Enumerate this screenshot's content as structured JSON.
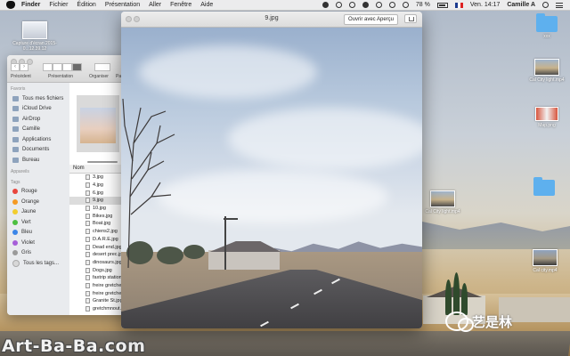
{
  "menubar": {
    "app": "Finder",
    "items": [
      "Fichier",
      "Édition",
      "Présentation",
      "Aller",
      "Fenêtre",
      "Aide"
    ],
    "battery": "78 %",
    "clock": "Ven. 14:17",
    "user": "Camille A"
  },
  "desktop": {
    "items": [
      {
        "label": "Capture d'écran 2015-0...12.39.12"
      },
      {
        "label": "xxx"
      },
      {
        "label": "Cal City light.mp4"
      },
      {
        "label": "Map.png"
      },
      {
        "label": "Cal City light.mp4"
      },
      {
        "label": ""
      },
      {
        "label": "Cal city.mp4"
      }
    ],
    "watermark": "Art-Ba-Ba.com",
    "wechat_text": "艺是林"
  },
  "finder": {
    "toolbar": {
      "back_label": "Précédent",
      "view_label": "Présentation",
      "arrange_label": "Organiser",
      "share_label": "Parta"
    },
    "sidebar": {
      "favorites_heading": "Favoris",
      "favorites": [
        "Tous mes fichiers",
        "iCloud Drive",
        "AirDrop",
        "Camille",
        "Applications",
        "Documents",
        "Bureau"
      ],
      "devices_heading": "Appareils",
      "tags_heading": "Tags",
      "tags": [
        {
          "label": "Rouge",
          "color": "#e8453c"
        },
        {
          "label": "Orange",
          "color": "#f59a23"
        },
        {
          "label": "Jaune",
          "color": "#f2cd2e"
        },
        {
          "label": "Vert",
          "color": "#4cbf3f"
        },
        {
          "label": "Bleu",
          "color": "#3b86e8"
        },
        {
          "label": "Violet",
          "color": "#a65ed8"
        },
        {
          "label": "Gris",
          "color": "#9a9a9a"
        }
      ],
      "all_tags": "Tous les tags..."
    },
    "column_header": "Nom",
    "files": [
      "3.jpg",
      "4.jpg",
      "6.jpg",
      "9.jpg",
      "10.jpg",
      "Bikes.jpg",
      "Boat.jpg",
      "chiens2.jpg",
      "D.A.R.E.jpg",
      "Dead end.jpg",
      "desert prec.jpg",
      "dinosaurs.jpg",
      "Dogs.jpg",
      "faxtrip station.jpg",
      "freire gretchen",
      "freire gretchen",
      "Granite St.jpg",
      "gretchmnout.jpg"
    ],
    "selected_file": "9.jpg"
  },
  "preview": {
    "title": "9.jpg",
    "open_button": "Ouvrir avec Aperçu"
  }
}
